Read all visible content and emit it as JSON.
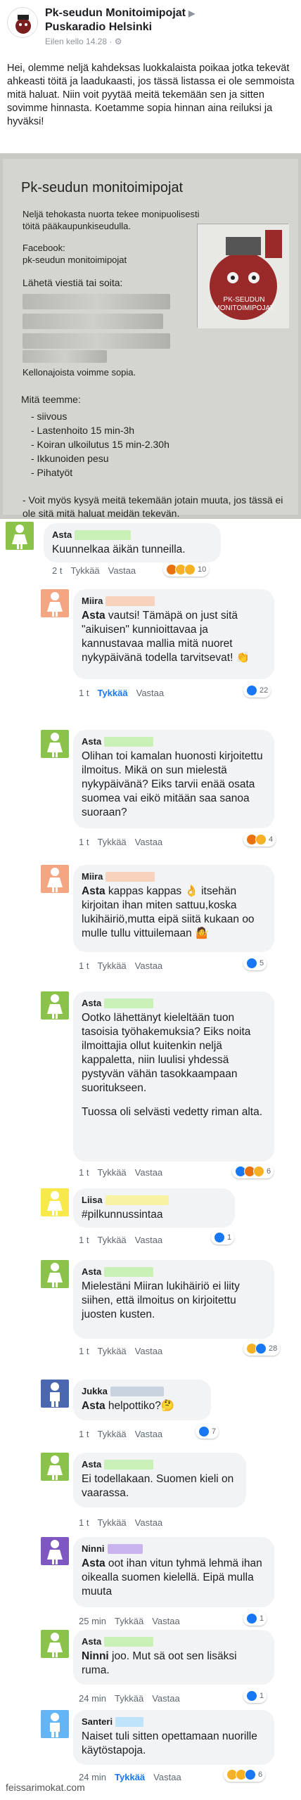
{
  "header": {
    "page_name": "Pk-seudun Monitoimipojat",
    "arrow": "▶",
    "target": "Puskaradio Helsinki",
    "time": "Eilen kello 14.28 · ⚙"
  },
  "post_text": "Hei, olemme neljä kahdeksas luokkalaista poikaa jotka tekevät ahkeasti töitä ja laadukaasti, jos tässä listassa ei ole semmoista mitä haluat. Niin voit pyytää meitä tekemään sen ja sitten sovimme hinnasta. Koetamme sopia hinnan aina reiluksi ja hyväksi!",
  "poster": {
    "title": "Pk-seudun monitoimipojat",
    "intro": "Neljä tehokasta nuorta tekee monipuolisesti töitä pääkaupunkiseudulla.",
    "facebook_label": "Facebook:",
    "facebook_name": "pk-seudun monitoimipojat",
    "message_line": "Lähetä viestiä tai soita:",
    "clock": "Kellonajoista voimme sopia.",
    "what_we_do": "Mitä teemme:",
    "services": [
      "- siivous",
      "- Lastenhoito 15 min-3h",
      "- Koiran ulkoilutus 15 min-2.30h",
      "- Ikkunoiden pesu",
      "- Pihatyöt"
    ],
    "extra": "- Voit myös kysyä meitä tekemään jotain muuta, jos tässä ei ole sitä mitä haluat meidän tekevän.",
    "drawing_caption": "PK-SEUDUN MONITOIMIPOJAT"
  },
  "comments": [
    {
      "name": "Asta",
      "text": "Kuunnelkaa äikän tunneilla.",
      "time": "2 t",
      "like": "Tykkää",
      "reply": "Vastaa",
      "count": "10"
    },
    {
      "name": "Miira",
      "mention": "Asta",
      "text": " vautsi! Tämäpä on just sitä \"aikuisen\" kunnioittavaa ja kannustavaa mallia mitä nuoret nykypäivänä todella tarvitsevat! 👏",
      "time": "1 t",
      "like": "Tykkää",
      "reply": "Vastaa",
      "count": "22"
    },
    {
      "name": "Asta",
      "text": "Olihan toi kamalan huonosti kirjoitettu ilmoitus. Mikä on sun mielestä nykypäivänä? Eiks tarvii enää osata suomea vai eikö mitään saa sanoa suoraan?",
      "time": "1 t",
      "like": "Tykkää",
      "reply": "Vastaa",
      "count": "4"
    },
    {
      "name": "Miira",
      "mention": "Asta",
      "text": " kappas kappas 👌 itsehän kirjoitan ihan miten sattuu,koska lukihäiriö,mutta eipä siitä kukaan oo mulle tullu vittuilemaan 🤷",
      "time": "1 t",
      "like": "Tykkää",
      "reply": "Vastaa",
      "count": "5"
    },
    {
      "name": "Asta",
      "text": "Ootko lähettänyt kieleltään tuon tasoisia työhakemuksia? Eiks noita ilmoittajia ollut kuitenkin neljä kappaletta, niin luulisi yhdessä pystyvän vähän tasokkaampaan suoritukseen.",
      "text2": "Tuossa oli selvästi vedetty riman alta.",
      "time": "1 t",
      "like": "Tykkää",
      "reply": "Vastaa",
      "count": "6"
    },
    {
      "name": "Liisa",
      "text": "#pilkunnussintaa",
      "time": "1 t",
      "like": "Tykkää",
      "reply": "Vastaa",
      "count": "1"
    },
    {
      "name": "Asta",
      "text": "Mielestäni Miiran lukihäiriö ei liity siihen, että ilmoitus on kirjoitettu juosten kusten.",
      "time": "1 t",
      "like": "Tykkää",
      "reply": "Vastaa",
      "count": "28"
    },
    {
      "name": "Jukka",
      "mention": "Asta",
      "text": " helpottiko?🤔",
      "time": "1 t",
      "like": "Tykkää",
      "reply": "Vastaa",
      "count": "7"
    },
    {
      "name": "Asta",
      "text": "Ei todellakaan. Suomen kieli on vaarassa.",
      "time": "1 t",
      "like": "Tykkää",
      "reply": "Vastaa",
      "count": ""
    },
    {
      "name": "Ninni",
      "mention": "Asta",
      "text": " oot ihan vitun tyhmä lehmä ihan oikealla suomen kielellä. Eipä mulla muuta",
      "time": "25 min",
      "like": "Tykkää",
      "reply": "Vastaa",
      "count": "1"
    },
    {
      "name": "Asta",
      "mention": "Ninni",
      "text": " joo. Mut sä oot sen lisäksi ruma.",
      "time": "24 min",
      "like": "Tykkää",
      "reply": "Vastaa",
      "count": "1"
    },
    {
      "name": "Santeri",
      "text": "Naiset tuli sitten opettamaan nuorille käytöstapoja.",
      "time": "24 min",
      "like": "Tykkää",
      "reply": "Vastaa",
      "count": "6"
    }
  ],
  "watermark": "feissarimokat.com",
  "colors": {
    "avatar_green": "#8bc34a",
    "avatar_orange": "#f4a582",
    "avatar_yellow": "#f7e84b",
    "avatar_blue": "#4a67b0",
    "avatar_purple": "#7e57c2",
    "avatar_lightblue": "#64b5f6",
    "blur_green": "#c9f0b6",
    "blur_peach": "#f8d2bc",
    "blur_yellow": "#f8f2a4",
    "blur_purple": "#c9b4ef",
    "blur_grey": "#c9d3e0",
    "blur_lightblue": "#bfe3fb",
    "like_blue": "#1877f2"
  }
}
